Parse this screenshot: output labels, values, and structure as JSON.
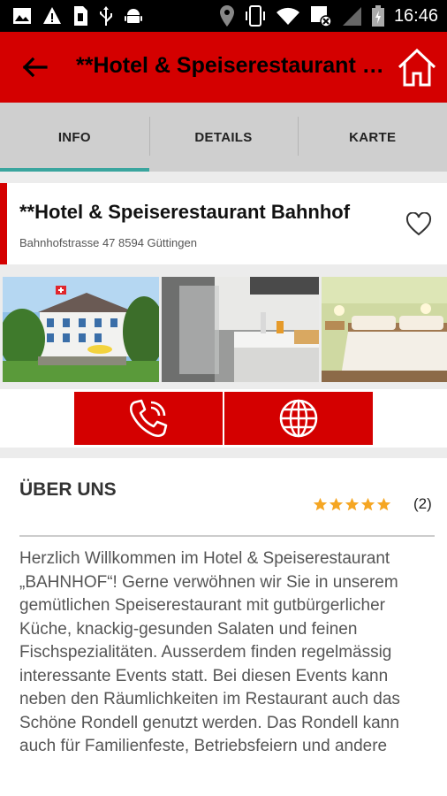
{
  "status_bar": {
    "time": "16:46",
    "left_icons": [
      "image-icon",
      "warning-icon",
      "sim-icon",
      "usb-icon",
      "android-icon"
    ],
    "right_icons": [
      "location-icon",
      "vibrate-icon",
      "wifi-icon",
      "sms-icon",
      "signal-icon",
      "battery-icon"
    ]
  },
  "app_bar": {
    "title": "**Hotel & Speiserestaurant Bahnhof",
    "back_icon": "arrow-back-icon",
    "home_icon": "home-icon",
    "background": "#d40000"
  },
  "tabs": [
    {
      "label": "INFO",
      "active": true
    },
    {
      "label": "DETAILS",
      "active": false
    },
    {
      "label": "KARTE",
      "active": false
    }
  ],
  "tab_indicator_color": "#3aa59e",
  "hotel": {
    "name": "**Hotel & Speiserestaurant Bahnhof",
    "address": "Bahnhofstrasse 47 8594  Güttingen",
    "favorite_icon": "heart-outline-icon"
  },
  "photos": [
    {
      "name": "hotel-exterior-photo"
    },
    {
      "name": "bathroom-photo"
    },
    {
      "name": "bedroom-photo"
    }
  ],
  "actions": [
    {
      "name": "call-button",
      "icon": "phone-icon"
    },
    {
      "name": "website-button",
      "icon": "globe-icon"
    }
  ],
  "about": {
    "title": "ÜBER UNS",
    "rating": 5,
    "rating_max": 5,
    "rating_count": "(2)",
    "star_color": "#f5a623",
    "text": "Herzlich Willkommen im Hotel & Speiserestaurant „BAHNHOF“! Gerne verwöhnen wir Sie in unserem gemütlichen Speiserestaurant mit gutbürgerlicher Küche, knackig-gesunden Salaten und feinen Fischspezialitäten. Ausserdem finden regelmässig interessante Events statt. Bei diesen Events kann neben den Räumlichkeiten im Restaurant auch das Schöne Rondell genutzt werden. Das Rondell kann auch für Familienfeste, Betriebsfeiern und andere"
  }
}
